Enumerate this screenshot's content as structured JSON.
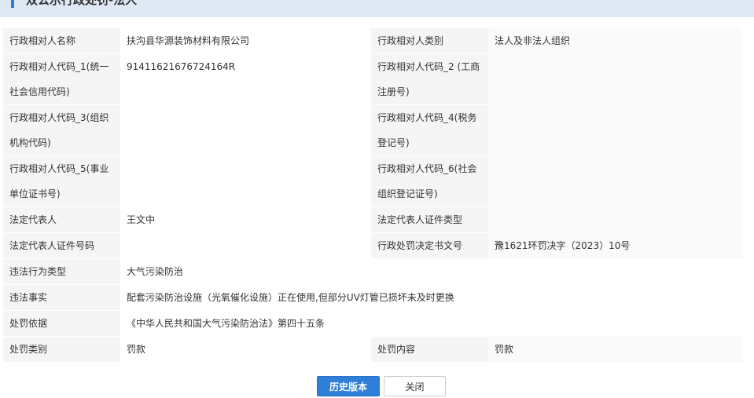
{
  "header": {
    "title": "双公示行政处罚-法人"
  },
  "rows": [
    {
      "l1": "行政相对人名称",
      "v1": "扶沟县华源装饰材料有限公司",
      "l2": "行政相对人类别",
      "v2": "法人及非法人组织"
    },
    {
      "l1": "行政相对人代码_1(统一社会信用代码)",
      "v1": "91411621676724164R",
      "l2": "行政相对人代码_2 (工商注册号)",
      "v2": ""
    },
    {
      "l1": "行政相对人代码_3(组织机构代码)",
      "v1": "",
      "l2": "行政相对人代码_4(税务登记号)",
      "v2": ""
    },
    {
      "l1": "行政相对人代码_5(事业单位证书号)",
      "v1": "",
      "l2": "行政相对人代码_6(社会组织登记证号)",
      "v2": ""
    },
    {
      "l1": "法定代表人",
      "v1": "王文中",
      "l2": "法定代表人证件类型",
      "v2": ""
    },
    {
      "l1": "法定代表人证件号码",
      "v1": "",
      "l2": "行政处罚决定书文号",
      "v2": "豫1621环罚决字（2023）10号"
    },
    {
      "l1": "违法行为类型",
      "v1": "大气污染防治"
    },
    {
      "l1": "违法事实",
      "v1": "配套污染防治设施（光氧催化设施）正在使用,但部分UV灯管已损坏未及时更换"
    },
    {
      "l1": "处罚依据",
      "v1": "《中华人民共和国大气污染防治法》第四十五条"
    },
    {
      "l1": "处罚类别",
      "v1": "罚款",
      "l2": "处罚内容",
      "v2": "罚款"
    }
  ],
  "buttons": {
    "history": "历史版本",
    "close": "关闭"
  }
}
